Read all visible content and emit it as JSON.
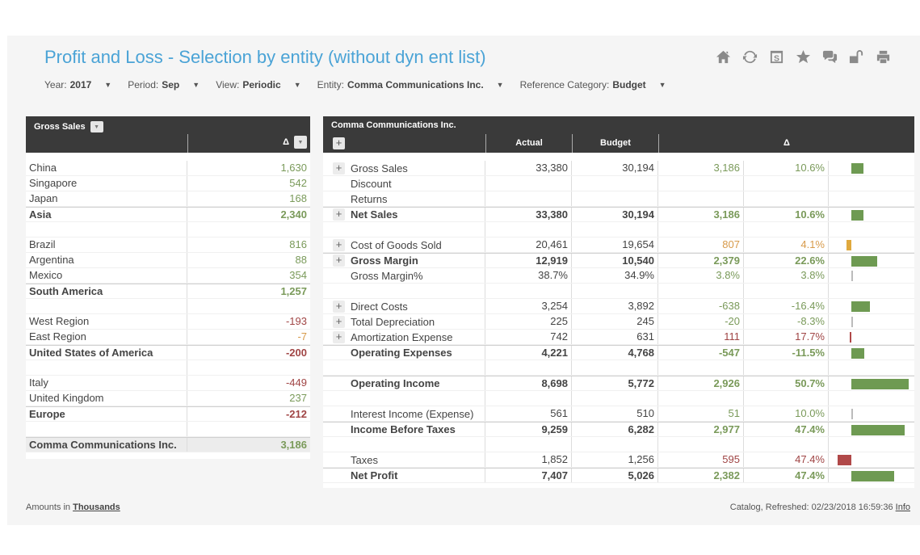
{
  "header": {
    "title": "Profit and Loss - Selection by entity (without dyn ent list)",
    "toolbar_icons": [
      "home-icon",
      "refresh-icon",
      "save-icon",
      "favorite-star-icon",
      "comments-icon",
      "unlock-icon",
      "print-icon"
    ]
  },
  "filters": [
    {
      "label": "Year:",
      "value": "2017"
    },
    {
      "label": "Period:",
      "value": "Sep"
    },
    {
      "label": "View:",
      "value": "Periodic"
    },
    {
      "label": "Entity:",
      "value": "Comma Communications Inc."
    },
    {
      "label": "Reference Category:",
      "value": "Budget"
    }
  ],
  "left_table": {
    "title": "Gross Sales",
    "delta_header": "Δ",
    "rows": [
      {
        "name": "China",
        "value": "1,630",
        "type": "item",
        "tone": "pos"
      },
      {
        "name": "Singapore",
        "value": "542",
        "type": "item",
        "tone": "pos"
      },
      {
        "name": "Japan",
        "value": "168",
        "type": "item",
        "tone": "pos"
      },
      {
        "name": "Asia",
        "value": "2,340",
        "type": "total",
        "tone": "pos"
      },
      {
        "name": "",
        "value": "",
        "type": "blank",
        "tone": ""
      },
      {
        "name": "Brazil",
        "value": "816",
        "type": "item",
        "tone": "pos"
      },
      {
        "name": "Argentina",
        "value": "88",
        "type": "item",
        "tone": "pos"
      },
      {
        "name": "Mexico",
        "value": "354",
        "type": "item",
        "tone": "pos"
      },
      {
        "name": "South America",
        "value": "1,257",
        "type": "total",
        "tone": "pos"
      },
      {
        "name": "",
        "value": "",
        "type": "blank",
        "tone": ""
      },
      {
        "name": "West Region",
        "value": "-193",
        "type": "item",
        "tone": "neg"
      },
      {
        "name": "East Region",
        "value": "-7",
        "type": "item",
        "tone": "warn"
      },
      {
        "name": "United States of America",
        "value": "-200",
        "type": "total",
        "tone": "neg"
      },
      {
        "name": "",
        "value": "",
        "type": "blank",
        "tone": ""
      },
      {
        "name": "Italy",
        "value": "-449",
        "type": "item",
        "tone": "neg"
      },
      {
        "name": "United Kingdom",
        "value": "237",
        "type": "item",
        "tone": "pos"
      },
      {
        "name": "Europe",
        "value": "-212",
        "type": "total",
        "tone": "neg"
      },
      {
        "name": "",
        "value": "",
        "type": "blank",
        "tone": ""
      },
      {
        "name": "Comma Communications Inc.",
        "value": "3,186",
        "type": "grand",
        "tone": "pos"
      }
    ]
  },
  "right_table": {
    "title": "Comma Communications Inc.",
    "columns": {
      "actual": "Actual",
      "budget": "Budget",
      "delta": "Δ"
    },
    "colors": {
      "pos_bar": "#6e9a52",
      "warn_bar": "#e0a93e",
      "neg_bar": "#b04848",
      "neutral_bar": "#bbbbbb"
    },
    "rows": [
      {
        "name": "Gross Sales",
        "expand": true,
        "actual": "33,380",
        "budget": "30,194",
        "dabs": "3,186",
        "dpct": "10.6%",
        "tone": "pos",
        "bar": 10.6,
        "type": "item"
      },
      {
        "name": "Discount",
        "expand": false,
        "actual": "",
        "budget": "",
        "dabs": "",
        "dpct": "",
        "tone": "",
        "bar": null,
        "type": "item"
      },
      {
        "name": "Returns",
        "expand": false,
        "actual": "",
        "budget": "",
        "dabs": "",
        "dpct": "",
        "tone": "",
        "bar": null,
        "type": "item"
      },
      {
        "name": "Net Sales",
        "expand": true,
        "actual": "33,380",
        "budget": "30,194",
        "dabs": "3,186",
        "dpct": "10.6%",
        "tone": "pos",
        "bar": 10.6,
        "type": "total"
      },
      {
        "name": "",
        "expand": false,
        "actual": "",
        "budget": "",
        "dabs": "",
        "dpct": "",
        "tone": "",
        "bar": null,
        "type": "blank"
      },
      {
        "name": "Cost of Goods Sold",
        "expand": true,
        "actual": "20,461",
        "budget": "19,654",
        "dabs": "807",
        "dpct": "4.1%",
        "tone": "warn",
        "bar": -4.1,
        "type": "item"
      },
      {
        "name": "Gross Margin",
        "expand": true,
        "actual": "12,919",
        "budget": "10,540",
        "dabs": "2,379",
        "dpct": "22.6%",
        "tone": "pos",
        "bar": 22.6,
        "type": "total"
      },
      {
        "name": "Gross Margin%",
        "expand": false,
        "actual": "38.7%",
        "budget": "34.9%",
        "dabs": "3.8%",
        "dpct": "3.8%",
        "tone": "pos",
        "bar": 0.3,
        "type": "item"
      },
      {
        "name": "",
        "expand": false,
        "actual": "",
        "budget": "",
        "dabs": "",
        "dpct": "",
        "tone": "",
        "bar": null,
        "type": "blank"
      },
      {
        "name": "Direct Costs",
        "expand": true,
        "actual": "3,254",
        "budget": "3,892",
        "dabs": "-638",
        "dpct": "-16.4%",
        "tone": "pos",
        "bar": 16.4,
        "type": "item"
      },
      {
        "name": "Total Depreciation",
        "expand": true,
        "actual": "225",
        "budget": "245",
        "dabs": "-20",
        "dpct": "-8.3%",
        "tone": "pos",
        "bar": 0.3,
        "type": "item"
      },
      {
        "name": "Amortization Expense",
        "expand": true,
        "actual": "742",
        "budget": "631",
        "dabs": "111",
        "dpct": "17.7%",
        "tone": "neg",
        "bar": -0.4,
        "type": "item"
      },
      {
        "name": "Operating Expenses",
        "expand": false,
        "actual": "4,221",
        "budget": "4,768",
        "dabs": "-547",
        "dpct": "-11.5%",
        "tone": "pos",
        "bar": 11.5,
        "type": "total"
      },
      {
        "name": "",
        "expand": false,
        "actual": "",
        "budget": "",
        "dabs": "",
        "dpct": "",
        "tone": "",
        "bar": null,
        "type": "blank"
      },
      {
        "name": "Operating Income",
        "expand": false,
        "actual": "8,698",
        "budget": "5,772",
        "dabs": "2,926",
        "dpct": "50.7%",
        "tone": "pos",
        "bar": 50.7,
        "type": "total"
      },
      {
        "name": "",
        "expand": false,
        "actual": "",
        "budget": "",
        "dabs": "",
        "dpct": "",
        "tone": "",
        "bar": null,
        "type": "blank"
      },
      {
        "name": "Interest Income (Expense)",
        "expand": false,
        "actual": "561",
        "budget": "510",
        "dabs": "51",
        "dpct": "10.0%",
        "tone": "pos",
        "bar": 0.3,
        "type": "item"
      },
      {
        "name": "Income Before Taxes",
        "expand": false,
        "actual": "9,259",
        "budget": "6,282",
        "dabs": "2,977",
        "dpct": "47.4%",
        "tone": "pos",
        "bar": 47.4,
        "type": "total"
      },
      {
        "name": "",
        "expand": false,
        "actual": "",
        "budget": "",
        "dabs": "",
        "dpct": "",
        "tone": "",
        "bar": null,
        "type": "blank"
      },
      {
        "name": "Taxes",
        "expand": false,
        "actual": "1,852",
        "budget": "1,256",
        "dabs": "595",
        "dpct": "47.4%",
        "tone": "neg",
        "bar": -12,
        "type": "item"
      },
      {
        "name": "Net Profit",
        "expand": false,
        "actual": "7,407",
        "budget": "5,026",
        "dabs": "2,382",
        "dpct": "47.4%",
        "tone": "pos",
        "bar": 38,
        "type": "total"
      }
    ]
  },
  "footer": {
    "amounts_prefix": "Amounts in",
    "amounts_unit": "Thousands",
    "refreshed_text": "Catalog, Refreshed: 02/23/2018 16:59:36",
    "info_link": "Info"
  }
}
